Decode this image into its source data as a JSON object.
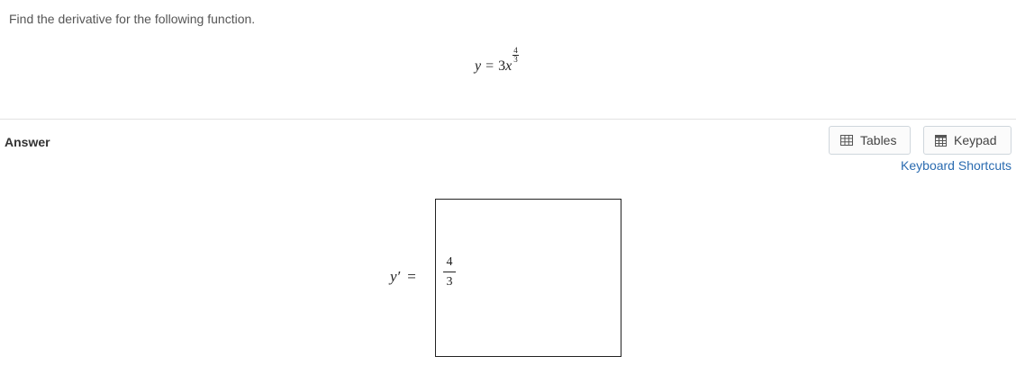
{
  "question": {
    "prompt": "Find the derivative for the following function."
  },
  "equation": {
    "lhs": "y",
    "op": "=",
    "coefficient": "3",
    "base": "x",
    "exponent_numerator": "4",
    "exponent_denominator": "3"
  },
  "answer": {
    "label": "Answer",
    "lhs": "y′",
    "op": "=",
    "input_numerator": "4",
    "input_denominator": "3"
  },
  "toolbar": {
    "tables_label": "Tables",
    "keypad_label": "Keypad",
    "shortcuts_label": "Keyboard Shortcuts"
  },
  "icons": {
    "tables": "table-grid-icon",
    "keypad": "keypad-icon"
  },
  "colors": {
    "link": "#2a6bb0",
    "border": "#cfd6dc",
    "divider": "#e2e2e2"
  }
}
